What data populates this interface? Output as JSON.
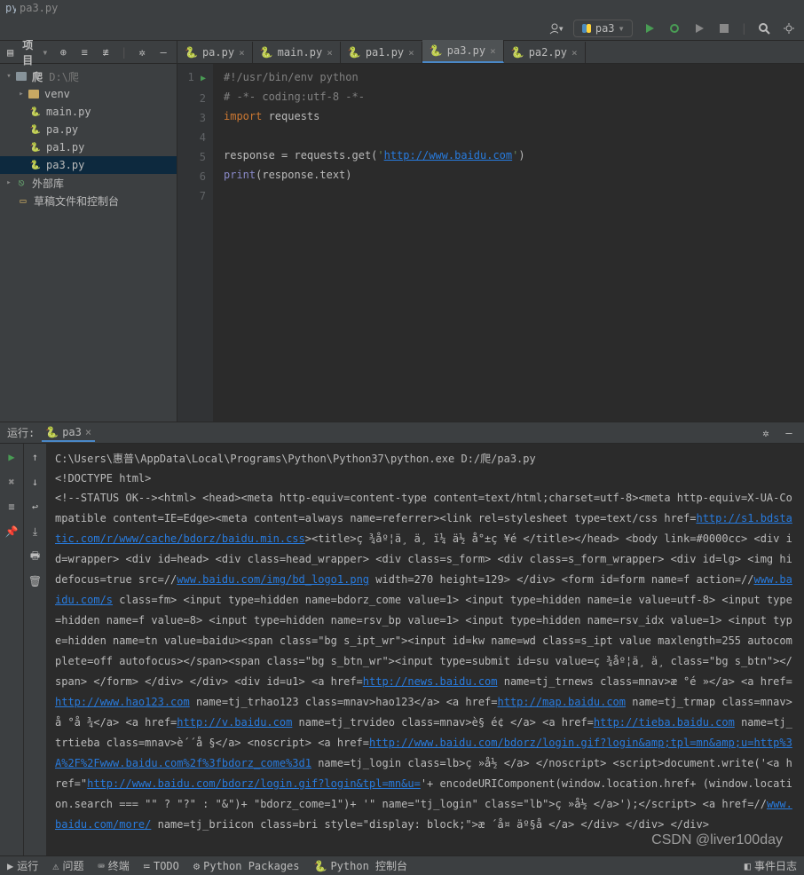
{
  "title": {
    "filename": "pa3.py"
  },
  "toolbar": {
    "run_config": "pa3"
  },
  "project": {
    "header": "项目",
    "root": {
      "label": "爬",
      "path": "D:\\爬"
    },
    "venv": "venv",
    "files": [
      "main.py",
      "pa.py",
      "pa1.py",
      "pa3.py"
    ],
    "ext_libs": "外部库",
    "scratches": "草稿文件和控制台"
  },
  "tabs": [
    {
      "label": "pa.py",
      "active": false
    },
    {
      "label": "main.py",
      "active": false
    },
    {
      "label": "pa1.py",
      "active": false
    },
    {
      "label": "pa3.py",
      "active": true
    },
    {
      "label": "pa2.py",
      "active": false
    }
  ],
  "code": {
    "l1": "#!/usr/bin/env python",
    "l2": "# -*- coding:utf-8 -*-",
    "l3_kw": "import",
    "l3_rest": " requests",
    "l5_a": "response = requests.get(",
    "l5_q": "'",
    "l5_url": "http://www.baidu.com",
    "l5_b": ")",
    "l6_a": "print",
    "l6_b": "(response.text)"
  },
  "run": {
    "label": "运行:",
    "tab": "pa3",
    "cmd": "C:\\Users\\惠普\\AppData\\Local\\Programs\\Python\\Python37\\python.exe D:/爬/pa3.py",
    "doctype": "<!DOCTYPE html>",
    "out1a": "<!--STATUS OK--><html> <head><meta http-equiv=content-type content=text/html;charset=utf-8><meta http-equiv=X-UA-Compatible content=IE=Edge><meta content=always name=referrer><link rel=stylesheet type=text/css href=",
    "link_css": "http://s1.bdstatic.com/r/www/cache/bdorz/baidu.min.css",
    "out1b": "><title>ç  ¾åº¦ä¸  ä¸  ï¼  ä½  å°±ç  ¥é    </title></head> <body link=#0000cc> <div id=wrapper> <div id=head> <div class=head_wrapper> <div class=s_form> <div class=s_form_wrapper> <div id=lg> <img hidefocus=true src=//",
    "link_logo": "www.baidu.com/img/bd_logo1.png",
    "out1c": " width=270 height=129> </div> <form id=form name=f action=//",
    "link_s": "www.baidu.com/s",
    "out1d": " class=fm> <input type=hidden name=bdorz_come value=1> <input type=hidden name=ie value=utf-8> <input type=hidden name=f value=8> <input type=hidden name=rsv_bp value=1> <input type=hidden name=rsv_idx value=1> <input type=hidden name=tn value=baidu><span class=\"bg s_ipt_wr\"><input id=kw name=wd class=s_ipt value maxlength=255 autocomplete=off autofocus></span><span class=\"bg s_btn_wr\"><input type=submit id=su value=ç  ¾åº¦ä¸  ä¸   class=\"bg s_btn\"></span> </form> </div> </div> <div id=u1> <a href=",
    "link_news": "http://news.baidu.com",
    "out2": " name=tj_trnews class=mnav>æ  °é  »</a> <a href=",
    "link_hao": "http://www.hao123.com",
    "out3": " name=tj_trhao123 class=mnav>hao123</a> <a href=",
    "link_map": "http://map.baidu.com",
    "out4": " name=tj_trmap class=mnav>å  °å  ¾</a> <a href=",
    "link_v": "http://v.baidu.com",
    "out5": " name=tj_trvideo class=mnav>è§  é¢  </a> <a href=",
    "link_tieba": "http://tieba.baidu.com",
    "out6": " name=tj_trtieba class=mnav>è´´å  §</a> <noscript> <a href=",
    "link_login": "http://www.baidu.com/bdorz/login.gif?login&amp;tpl=mn&amp;u=http%3A%2F%2Fwww.baidu.com%2f%3fbdorz_come%3d1",
    "out7": " name=tj_login class=lb>ç  »å½  </a> </noscript> <script>document.write('<a href=\"",
    "link_login2": "http://www.baidu.com/bdorz/login.gif?login&tpl=mn&u=",
    "out8": "'+ encodeURIComponent(window.location.href+ (window.location.search === \"\" ? \"?\" : \"&\")+ \"bdorz_come=1\")+ '\" name=\"tj_login\" class=\"lb\">ç  »å½  </a>');</script> <a href=//",
    "link_more": "www.baidu.com/more/",
    "out9": " name=tj_briicon class=bri style=\"display: block;\">æ  ´å¤  äº§å      </a> </div> </div> </div>"
  },
  "statusbar": {
    "run": "运行",
    "problems": "问题",
    "terminal": "终端",
    "todo": "TODO",
    "pypkg": "Python Packages",
    "pyconsole": "Python 控制台",
    "eventlog": "事件日志"
  },
  "watermark": "CSDN @liver100day"
}
